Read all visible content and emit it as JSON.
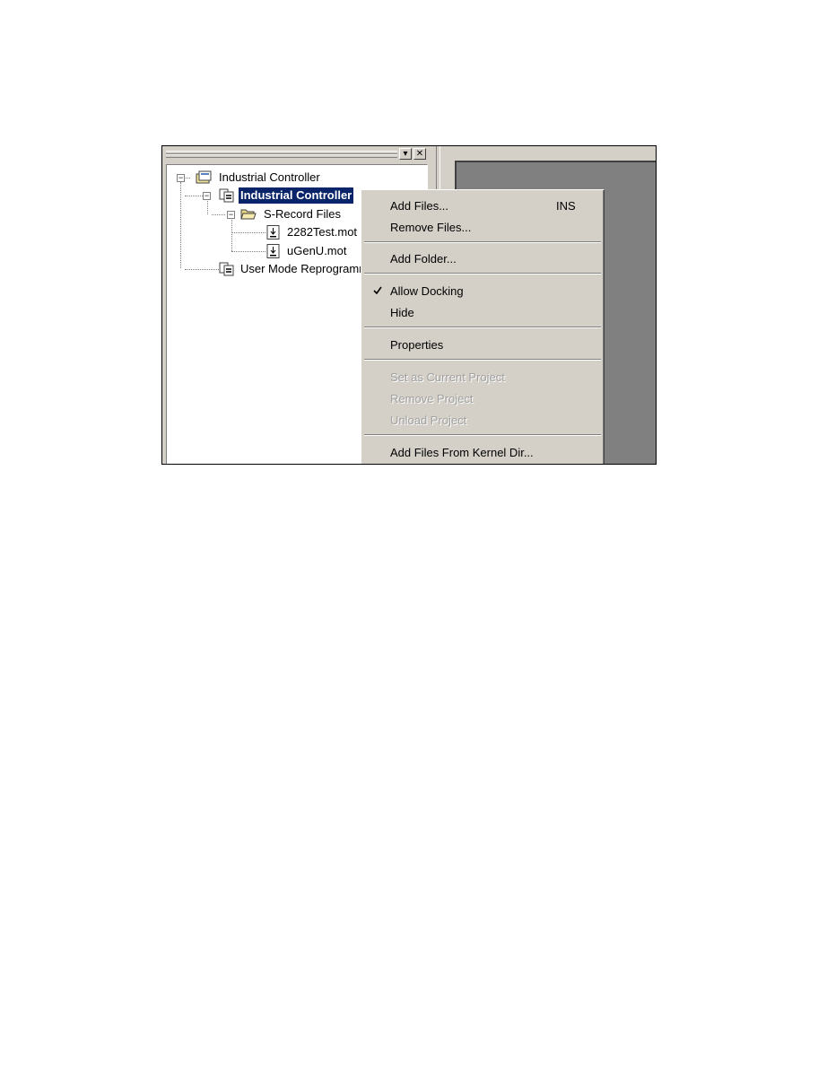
{
  "panel": {
    "minimize_icon": "▾",
    "close_icon": "✕"
  },
  "tree": {
    "root": "Industrial Controller",
    "project": "Industrial Controller",
    "folder": "S-Record Files",
    "file1": "2282Test.mot",
    "file2": "uGenU.mot",
    "project2": "User Mode Reprogramming",
    "expand_sign": "−"
  },
  "menu": {
    "items": [
      {
        "label": "Add Files...",
        "shortcut": "INS",
        "enabled": true
      },
      {
        "label": "Remove Files...",
        "enabled": true
      },
      {
        "label": "Add Folder...",
        "enabled": true
      },
      {
        "label": "Allow Docking",
        "checked": true,
        "enabled": true
      },
      {
        "label": "Hide",
        "enabled": true
      },
      {
        "label": "Properties",
        "enabled": true
      },
      {
        "label": "Set as Current Project",
        "enabled": false
      },
      {
        "label": "Remove Project",
        "enabled": false
      },
      {
        "label": "Unload Project",
        "enabled": false
      },
      {
        "label": "Add Files From Kernel Dir...",
        "enabled": true
      }
    ]
  },
  "colors": {
    "selection": "#0a246a",
    "face": "#d4d0c8",
    "workspace": "#808080"
  }
}
